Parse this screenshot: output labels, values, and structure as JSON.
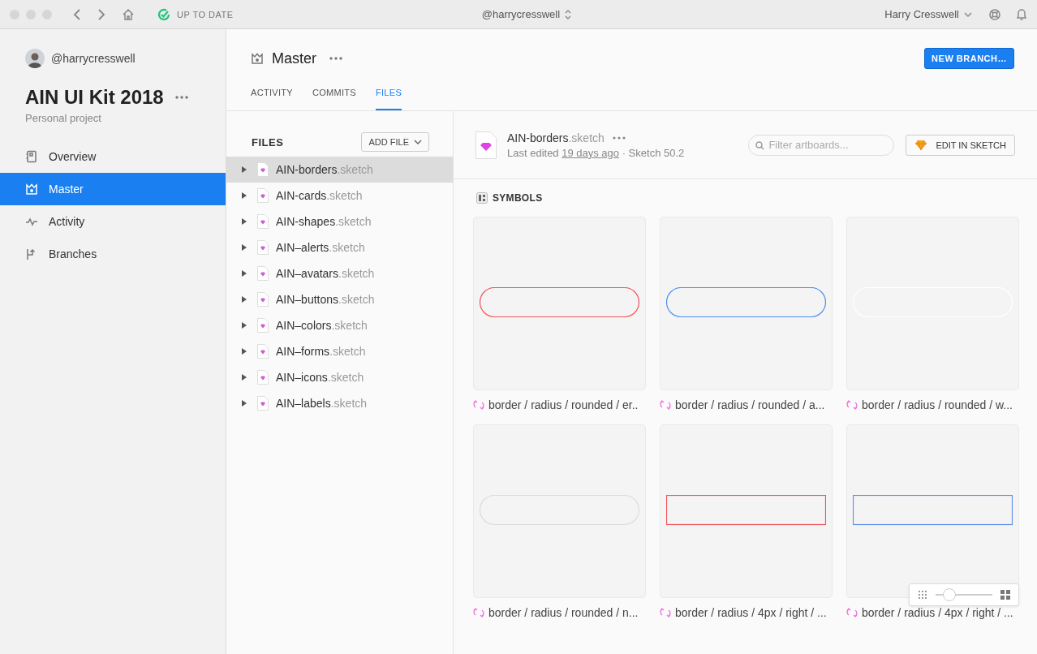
{
  "titlebar": {
    "status": "UP TO DATE",
    "account": "@harrycresswell",
    "user": "Harry Cresswell"
  },
  "sidebar": {
    "username": "@harrycresswell",
    "project": "AIN UI Kit 2018",
    "subtitle": "Personal project",
    "items": [
      {
        "label": "Overview",
        "selected": false
      },
      {
        "label": "Master",
        "selected": true
      },
      {
        "label": "Activity",
        "selected": false
      },
      {
        "label": "Branches",
        "selected": false
      }
    ]
  },
  "header": {
    "title": "Master",
    "button": "NEW BRANCH…",
    "tabs": [
      {
        "label": "ACTIVITY",
        "selected": false
      },
      {
        "label": "COMMITS",
        "selected": false
      },
      {
        "label": "FILES",
        "selected": true
      }
    ]
  },
  "files": {
    "title": "FILES",
    "add_button": "ADD FILE",
    "items": [
      {
        "name": "AIN-borders",
        "ext": ".sketch",
        "selected": true,
        "expanded": false
      },
      {
        "name": "AIN-cards",
        "ext": ".sketch",
        "selected": false,
        "expanded": false
      },
      {
        "name": "AIN-shapes",
        "ext": ".sketch",
        "selected": false,
        "expanded": false
      },
      {
        "name": "AIN–alerts",
        "ext": ".sketch",
        "selected": false,
        "expanded": false
      },
      {
        "name": "AIN–avatars",
        "ext": ".sketch",
        "selected": false,
        "expanded": false
      },
      {
        "name": "AIN–buttons",
        "ext": ".sketch",
        "selected": false,
        "expanded": false
      },
      {
        "name": "AIN–colors",
        "ext": ".sketch",
        "selected": false,
        "expanded": false
      },
      {
        "name": "AIN–forms",
        "ext": ".sketch",
        "selected": false,
        "expanded": false
      },
      {
        "name": "AIN–icons",
        "ext": ".sketch",
        "selected": false,
        "expanded": false
      },
      {
        "name": "AIN–labels",
        "ext": ".sketch",
        "selected": false,
        "expanded": false
      }
    ]
  },
  "detail": {
    "name": "AIN-borders",
    "ext": ".sketch",
    "edited_prefix": "Last edited ",
    "edited_link": "19 days ago",
    "version": " · Sketch 50.2",
    "filter_placeholder": "Filter artboards...",
    "edit_button": "EDIT IN SKETCH",
    "section": "SYMBOLS",
    "symbols": [
      {
        "label": "border / radius / rounded / er..",
        "kind": "pill",
        "color": "#f0555a"
      },
      {
        "label": "border / radius / rounded / a...",
        "kind": "pill",
        "color": "#4a90f0"
      },
      {
        "label": "border / radius / rounded / w...",
        "kind": "pill",
        "color": "#ffffff"
      },
      {
        "label": "border / radius / rounded / n...",
        "kind": "pill",
        "color": "#dcdcdc"
      },
      {
        "label": "border / radius / 4px / right / ...",
        "kind": "rect",
        "color": "#f0555a"
      },
      {
        "label": "border / radius / 4px / right / ...",
        "kind": "rect",
        "color": "#5b8ee8"
      }
    ]
  },
  "zoom": {
    "level": 0.15
  }
}
